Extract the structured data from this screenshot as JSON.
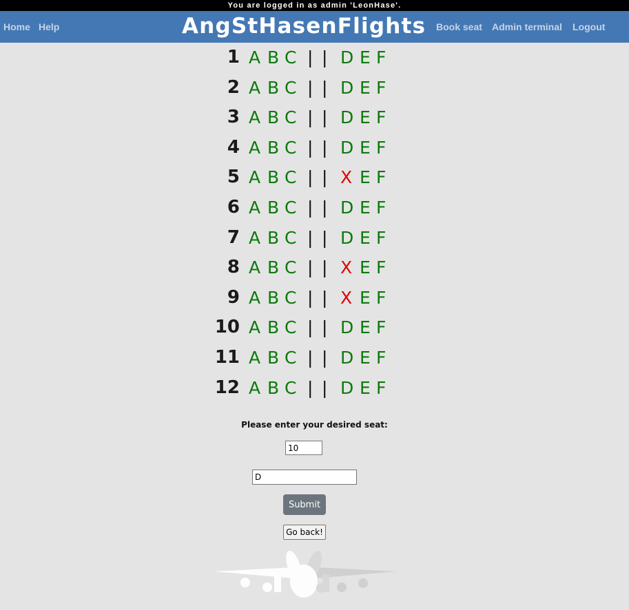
{
  "topbar": {
    "login_text": "You are logged in as admin 'LeonHase'."
  },
  "nav": {
    "home": "Home",
    "help": "Help",
    "brand": "AngStHasenFlights",
    "book_seat": "Book seat",
    "admin_terminal": "Admin terminal",
    "logout": "Logout"
  },
  "seat_map": {
    "aisle_left": "|",
    "aisle_right": "|",
    "rows": [
      {
        "num": "1",
        "seats": [
          "A",
          "B",
          "C",
          "D",
          "E",
          "F"
        ]
      },
      {
        "num": "2",
        "seats": [
          "A",
          "B",
          "C",
          "D",
          "E",
          "F"
        ]
      },
      {
        "num": "3",
        "seats": [
          "A",
          "B",
          "C",
          "D",
          "E",
          "F"
        ]
      },
      {
        "num": "4",
        "seats": [
          "A",
          "B",
          "C",
          "D",
          "E",
          "F"
        ]
      },
      {
        "num": "5",
        "seats": [
          "A",
          "B",
          "C",
          "X",
          "E",
          "F"
        ]
      },
      {
        "num": "6",
        "seats": [
          "A",
          "B",
          "C",
          "D",
          "E",
          "F"
        ]
      },
      {
        "num": "7",
        "seats": [
          "A",
          "B",
          "C",
          "D",
          "E",
          "F"
        ]
      },
      {
        "num": "8",
        "seats": [
          "A",
          "B",
          "C",
          "X",
          "E",
          "F"
        ]
      },
      {
        "num": "9",
        "seats": [
          "A",
          "B",
          "C",
          "X",
          "E",
          "F"
        ]
      },
      {
        "num": "10",
        "seats": [
          "A",
          "B",
          "C",
          "D",
          "E",
          "F"
        ]
      },
      {
        "num": "11",
        "seats": [
          "A",
          "B",
          "C",
          "D",
          "E",
          "F"
        ]
      },
      {
        "num": "12",
        "seats": [
          "A",
          "B",
          "C",
          "D",
          "E",
          "F"
        ]
      }
    ]
  },
  "form": {
    "prompt": "Please enter your desired seat:",
    "row_value": "10",
    "letter_value": "D",
    "submit_label": "Submit",
    "back_label": "Go back!"
  },
  "colors": {
    "navbar": "#4478b4",
    "available_seat": "#0b7a0b",
    "taken_seat": "#e00000",
    "background": "#e4e4e4"
  },
  "icons": {
    "footer": "airplane-bunny-icon"
  }
}
